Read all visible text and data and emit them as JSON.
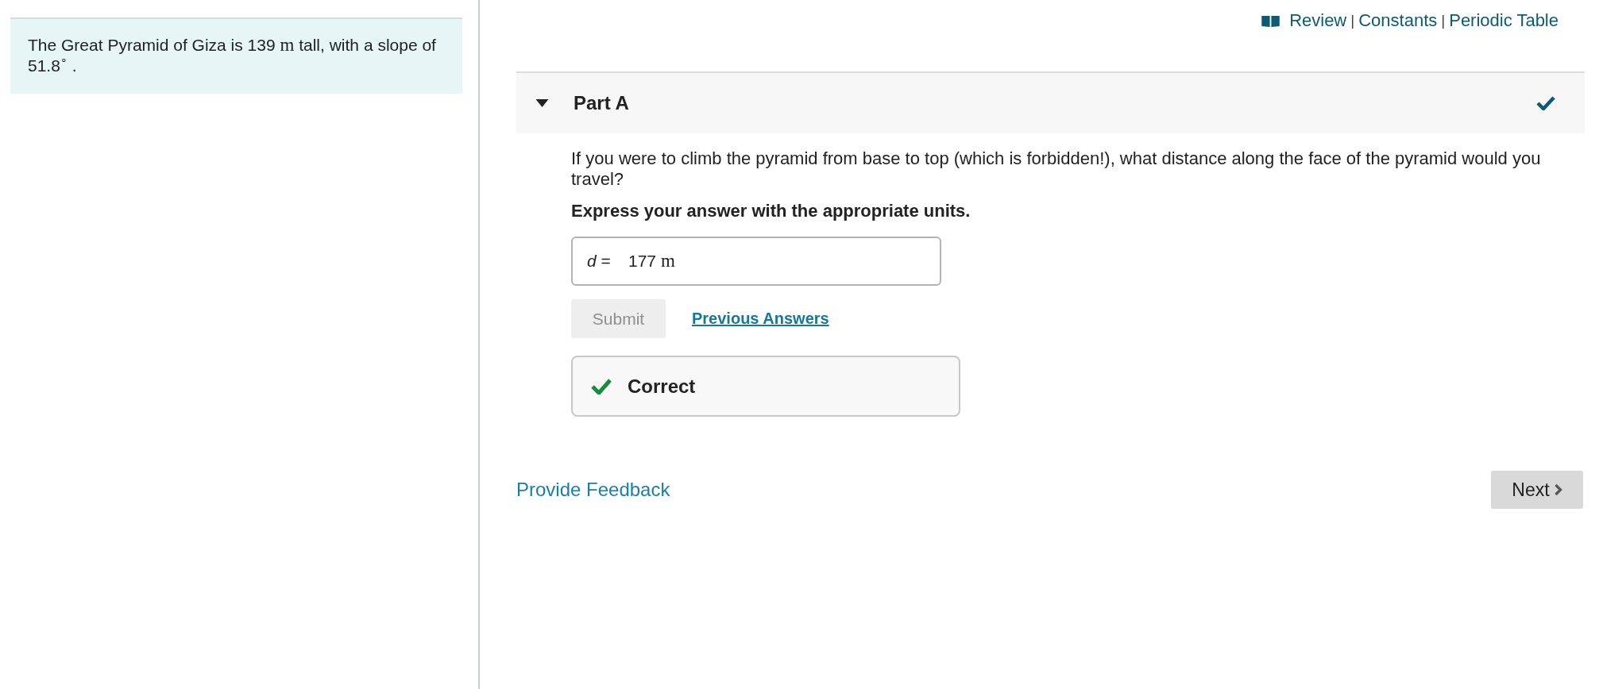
{
  "intro": {
    "segments": [
      {
        "kind": "text",
        "text": "The Great Pyramid of Giza is 139 "
      },
      {
        "kind": "unit",
        "text": "m"
      },
      {
        "kind": "text",
        "text": " tall, with a slope of 51.8$^{∘}$ ."
      }
    ]
  },
  "toolbar": [
    {
      "kind": "link",
      "text": "Review"
    },
    {
      "kind": "separator",
      "text": "|"
    },
    {
      "kind": "link",
      "text": "Constants"
    },
    {
      "kind": "separator",
      "text": "|"
    },
    {
      "kind": "link",
      "text": "Periodic Table"
    }
  ],
  "part": {
    "title": "Part A",
    "expanded": true,
    "completed": true,
    "question": "If you were to climb the pyramid from base to top (which is forbidden!), what distance along the face of the pyramid would you travel?",
    "instruction": "Express your answer with the appropriate units.",
    "answer": {
      "label": "*d* =",
      "value": "177",
      "unit": "m"
    },
    "submit": {
      "label": "Submit",
      "disabled": true
    },
    "previous_answers": "Previous Answers",
    "feedback": {
      "kind": "correct",
      "text": "Correct"
    }
  },
  "footer": {
    "feedback_link": "Provide Feedback",
    "next": "Next"
  }
}
